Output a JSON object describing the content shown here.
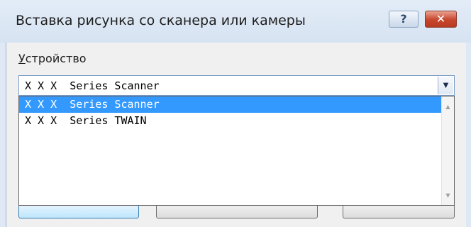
{
  "window": {
    "title": "Вставка рисунка со сканера или камеры",
    "help_glyph": "?",
    "close_glyph": "✕"
  },
  "device": {
    "label": "Устройство",
    "selected_value": "X X X  Series Scanner",
    "arrow_glyph": "▼"
  },
  "dropdown": {
    "items": [
      {
        "label": "X X X  Series Scanner",
        "selected": true
      },
      {
        "label": "X X X  Series TWAIN",
        "selected": false
      }
    ],
    "scroll_up_glyph": "▲",
    "scroll_down_glyph": "▼"
  },
  "colors": {
    "selection": "#3399ff",
    "title_bar": "#dfe9f5",
    "close_button": "#c7452c"
  }
}
